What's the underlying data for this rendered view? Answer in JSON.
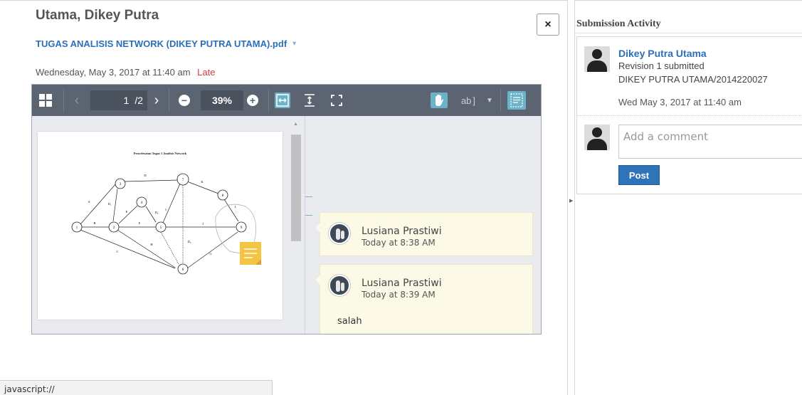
{
  "submission": {
    "student_name": "Utama, Dikey Putra",
    "file_name": "TUGAS ANALISIS NETWORK (DIKEY PUTRA UTAMA).pdf",
    "file_caret": "▾",
    "date": "Wednesday, May 3, 2017 at 11:40 am",
    "late_label": "Late",
    "close_label": "×"
  },
  "viewer": {
    "prev_label": "‹",
    "next_label": "›",
    "current_page": "1",
    "page_total": "/2",
    "zoom": "39%",
    "zoom_out": "−",
    "zoom_in": "+",
    "text_tool": "ab",
    "document": {
      "title": "Penyelesaian Tugas 1 Analisis Network",
      "node_labels": [
        "1",
        "2",
        "3",
        "4",
        "5",
        "6",
        "7",
        "8",
        "9"
      ],
      "edge_labels": [
        "A",
        "B",
        "C",
        "D",
        "D₁",
        "E",
        "F",
        "H",
        "I",
        "J",
        "K",
        "L",
        "G",
        "D₂",
        "D₃"
      ]
    },
    "comments": [
      {
        "author": "Lusiana Prastiwi",
        "time": "Today at 8:38 AM",
        "body": ""
      },
      {
        "author": "Lusiana Prastiwi",
        "time": "Today at 8:39 AM",
        "body": "salah"
      }
    ]
  },
  "status_bar": {
    "text": "javascript://"
  },
  "activity": {
    "header": "Submission Activity",
    "user_name": "Dikey Putra Utama",
    "revision": "Revision 1 submitted",
    "user_id": "DIKEY PUTRA UTAMA/2014220027",
    "date": "Wed May 3, 2017 at 11:40 am",
    "comment_placeholder": "Add a comment",
    "post_label": "Post"
  },
  "colors": {
    "link_blue": "#2a6fb8",
    "late_red": "#d23b3b",
    "toolbar_bg": "#5b6470",
    "toolbar_active": "#6bb3c9",
    "comment_bg": "#fcfae6",
    "sticky_note": "#f5c442",
    "post_button": "#2f73b8"
  }
}
